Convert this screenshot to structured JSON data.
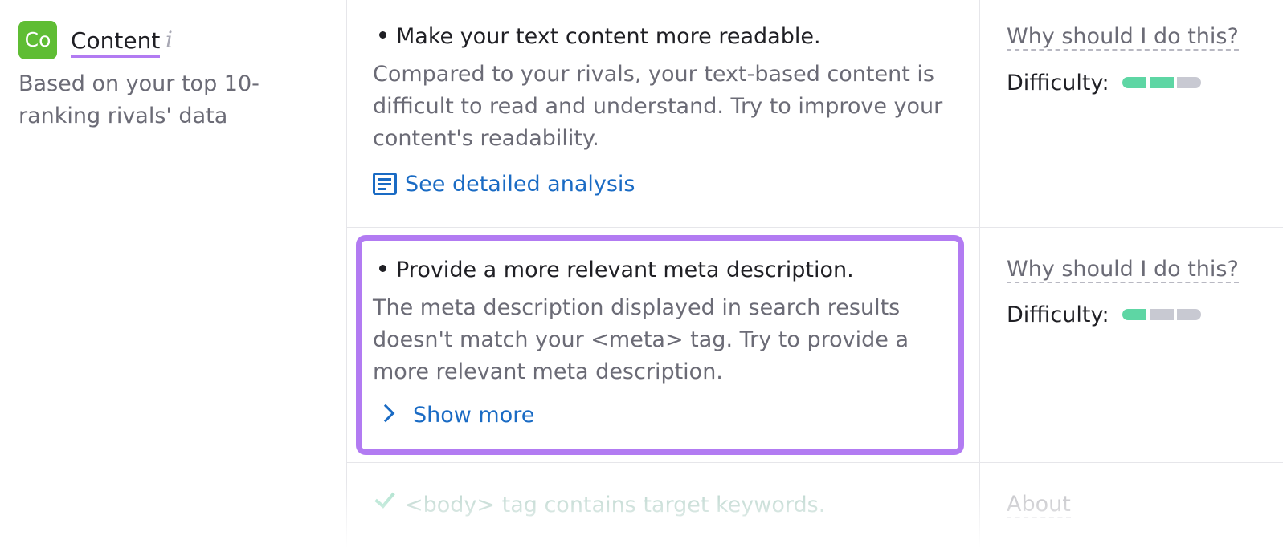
{
  "category": {
    "badge": "Co",
    "title": "Content",
    "info_icon": "i",
    "subtitle": "Based on your top 10-ranking rivals' data",
    "badge_color": "#5fbd34"
  },
  "issues": [
    {
      "title": "Make your text content more readable.",
      "description": "Compared to your rivals, your text-based content is difficult to read and understand. Try to improve your content's readability.",
      "link_label": "See detailed analysis",
      "link_icon": "document-icon",
      "why_label": "Why should I do this?",
      "difficulty_label": "Difficulty:",
      "difficulty_level": 2,
      "difficulty_max": 3
    },
    {
      "title": "Provide a more relevant meta description.",
      "description": "The meta description displayed in search results doesn't match your <meta> tag. Try to provide a more relevant meta description.",
      "link_label": "Show more",
      "link_icon": "chevron-right-icon",
      "why_label": "Why should I do this?",
      "difficulty_label": "Difficulty:",
      "difficulty_level": 1,
      "difficulty_max": 3,
      "highlighted": true
    },
    {
      "title": "<body> tag contains target keywords.",
      "status_icon": "check-icon",
      "about_label": "About",
      "faded": true
    }
  ],
  "colors": {
    "accent_purple": "#b27bf2",
    "link_blue": "#1a6bc4",
    "difficulty_on": "#5ed6a4",
    "difficulty_off": "#c8c9d2"
  }
}
